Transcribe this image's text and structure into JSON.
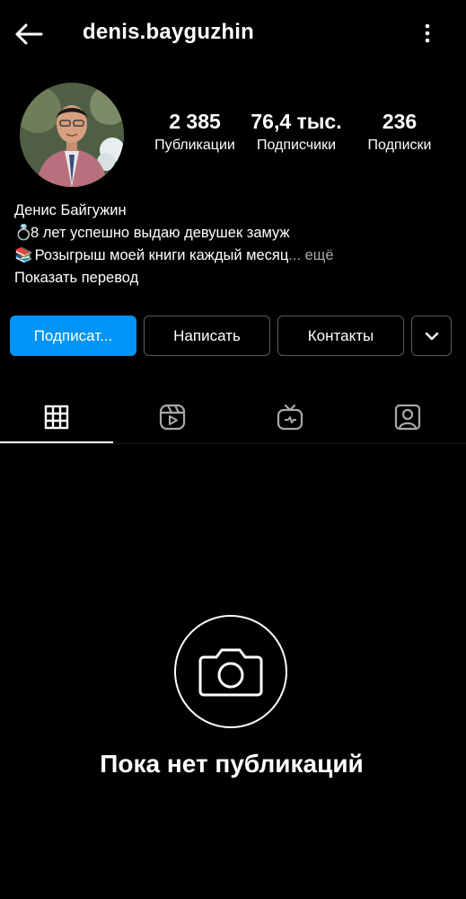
{
  "header": {
    "username": "denis.bayguzhin",
    "back_icon": "arrow-left-icon",
    "menu_icon": "more-vertical-icon"
  },
  "profile": {
    "stats": {
      "posts": {
        "value": "2 385",
        "label": "Публикации"
      },
      "followers": {
        "value": "76,4 тыс.",
        "label": "Подписчики"
      },
      "following": {
        "value": "236",
        "label": "Подписки"
      }
    },
    "bio": {
      "name": "Денис Байгужин",
      "line1_emoji": "💍",
      "line1": "8 лет успешно выдаю девушек замуж",
      "line2_emoji": "📚",
      "line2": "Розыгрыш моей книги каждый месяц",
      "more": "... ещё",
      "translate": "Показать перевод"
    }
  },
  "actions": {
    "follow": "Подписат...",
    "message": "Написать",
    "contacts": "Контакты"
  },
  "tabs": [
    "grid-icon",
    "reels-icon",
    "igtv-icon",
    "tagged-icon"
  ],
  "empty_state": {
    "icon": "camera-icon",
    "text": "Пока нет публикаций"
  },
  "colors": {
    "background": "#000000",
    "accent": "#0095f6",
    "muted": "#a8a8a8",
    "border": "#5a5a5a"
  }
}
